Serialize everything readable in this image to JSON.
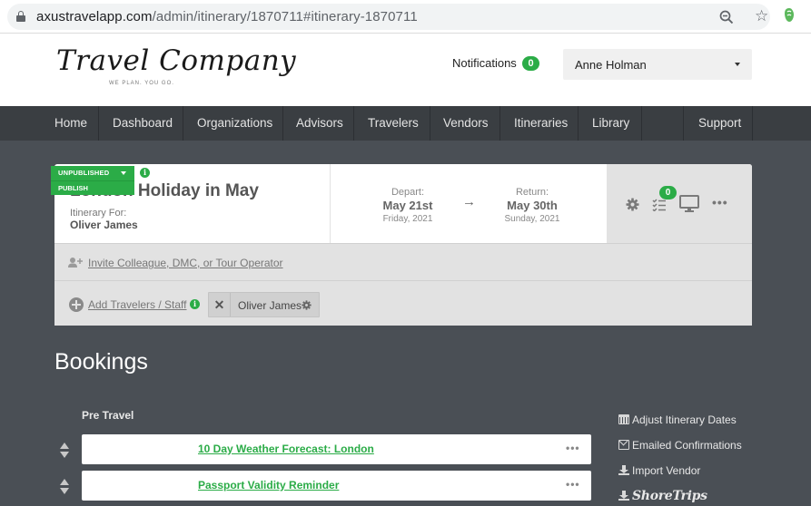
{
  "browser": {
    "url_host": "axustravelapp.com",
    "url_path": "/admin/itinerary/1870711#itinerary-1870711"
  },
  "header": {
    "logo_text": "Travel Company",
    "logo_tagline": "WE PLAN. YOU GO.",
    "notifications_label": "Notifications",
    "notifications_count": "0",
    "user_name": "Anne Holman"
  },
  "nav": {
    "items": [
      "Home",
      "Dashboard",
      "Organizations",
      "Advisors",
      "Travelers",
      "Vendors",
      "Itineraries",
      "Library"
    ],
    "support": "Support"
  },
  "itinerary": {
    "status": "UNPUBLISHED",
    "status_option": "PUBLISH",
    "title": "London Holiday in May",
    "for_label": "Itinerary For:",
    "for_name": "Oliver James",
    "depart": {
      "label": "Depart:",
      "date": "May 21st",
      "weekday": "Friday, 2021"
    },
    "return": {
      "label": "Return:",
      "date": "May 30th",
      "weekday": "Sunday, 2021"
    },
    "arrow": "→",
    "checklist_count": "0",
    "invite_link": "Invite Colleague, DMC, or Tour Operator",
    "add_travelers_link": "Add Travelers / Staff",
    "traveler_chip": "Oliver James"
  },
  "bookings": {
    "title": "Bookings",
    "section": "Pre Travel",
    "items": [
      {
        "title": "10 Day Weather Forecast: London"
      },
      {
        "title": "Passport Validity Reminder"
      }
    ],
    "side_actions": {
      "adjust_dates": "Adjust Itinerary Dates",
      "emailed_confirmations": "Emailed Confirmations",
      "import_vendor": "Import Vendor",
      "shoretrips": "ShoreTrips"
    }
  },
  "colors": {
    "accent_green": "#2bac47",
    "nav_bg": "#3a3e42",
    "page_bg": "#4a4f55"
  }
}
